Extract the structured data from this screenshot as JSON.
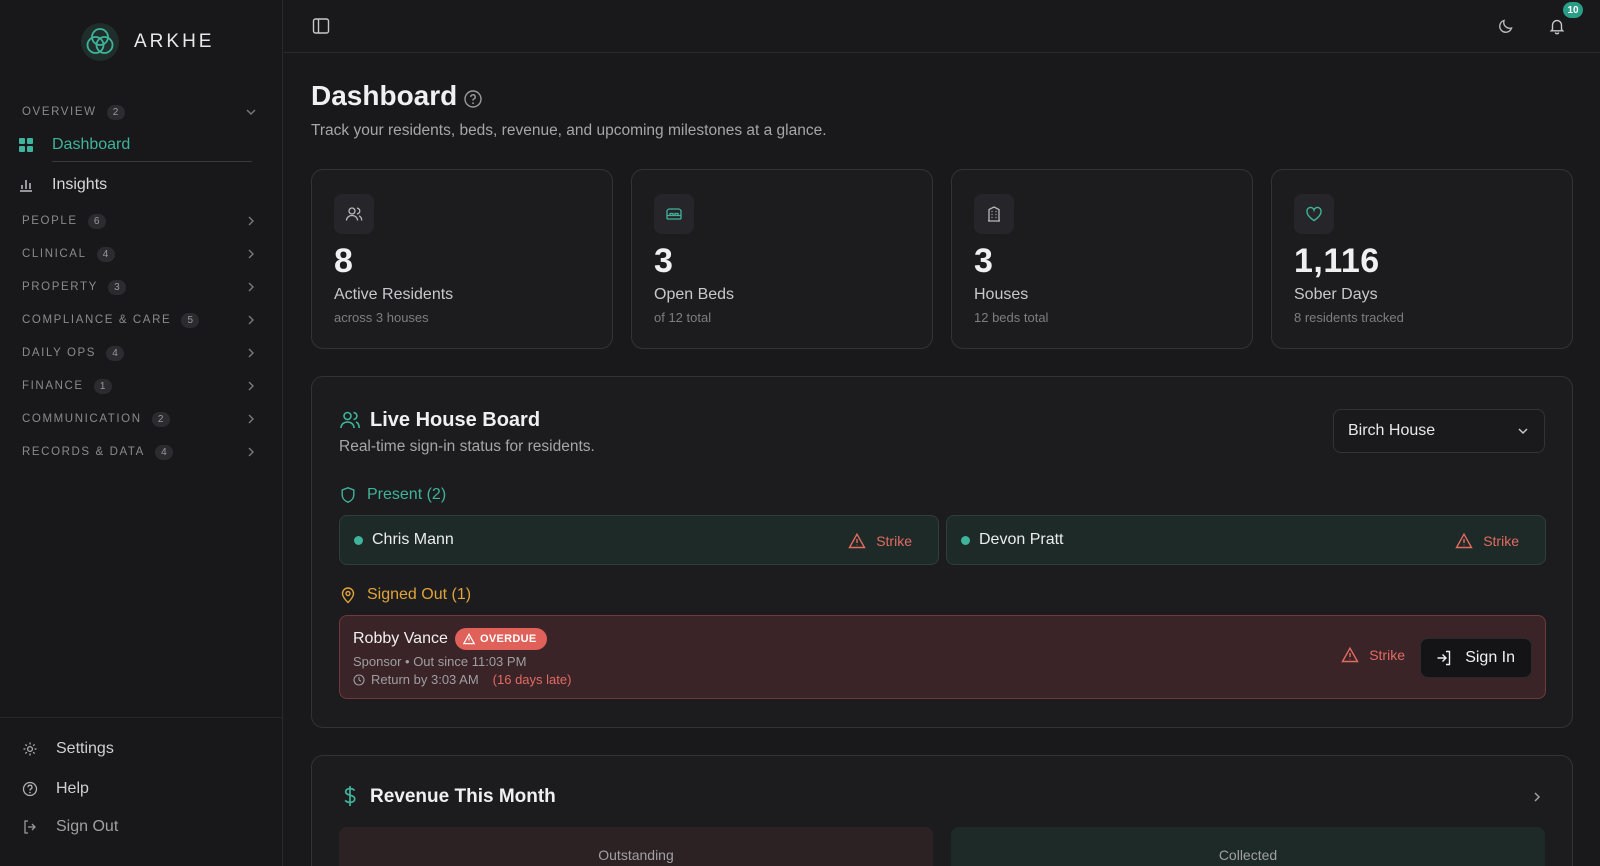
{
  "app": {
    "name": "ARKHE"
  },
  "sidebar": {
    "overview": {
      "label": "OVERVIEW",
      "count": "2"
    },
    "items": [
      {
        "label": "Dashboard"
      },
      {
        "label": "Insights"
      }
    ],
    "groups": [
      {
        "label": "PEOPLE",
        "count": "6"
      },
      {
        "label": "CLINICAL",
        "count": "4"
      },
      {
        "label": "PROPERTY",
        "count": "3"
      },
      {
        "label": "COMPLIANCE & CARE",
        "count": "5"
      },
      {
        "label": "DAILY OPS",
        "count": "4"
      },
      {
        "label": "FINANCE",
        "count": "1"
      },
      {
        "label": "COMMUNICATION",
        "count": "2"
      },
      {
        "label": "RECORDS & DATA",
        "count": "4"
      }
    ],
    "bottom": {
      "settings": "Settings",
      "help": "Help",
      "signout": "Sign Out"
    }
  },
  "topbar": {
    "notification_count": "10"
  },
  "page": {
    "title": "Dashboard",
    "subtitle": "Track your residents, beds, revenue, and upcoming milestones at a glance."
  },
  "stats": [
    {
      "value": "8",
      "label": "Active Residents",
      "sub": "across 3 houses",
      "icon": "users-icon"
    },
    {
      "value": "3",
      "label": "Open Beds",
      "sub": "of 12 total",
      "icon": "bed-icon"
    },
    {
      "value": "3",
      "label": "Houses",
      "sub": "12 beds total",
      "icon": "building-icon"
    },
    {
      "value": "1,116",
      "label": "Sober Days",
      "sub": "8 residents tracked",
      "icon": "heart-icon"
    }
  ],
  "house_board": {
    "title": "Live House Board",
    "subtitle": "Real-time sign-in status for residents.",
    "selected_house": "Birch House",
    "present_label": "Present (2)",
    "present": [
      {
        "name": "Chris Mann",
        "action": "Strike"
      },
      {
        "name": "Devon Pratt",
        "action": "Strike"
      }
    ],
    "signed_out_label": "Signed Out (1)",
    "signed_out": [
      {
        "name": "Robby Vance",
        "badge": "OVERDUE",
        "meta": "Sponsor • Out since 11:03 PM",
        "return": "Return by 3:03 AM",
        "late": "(16 days late)",
        "strike": "Strike",
        "signin": "Sign In"
      }
    ]
  },
  "revenue": {
    "title": "Revenue This Month",
    "outstanding_label": "Outstanding",
    "collected_label": "Collected"
  },
  "colors": {
    "accent": "#3fb39b",
    "warning": "#e0a33a",
    "danger": "#e36b62",
    "background": "#19191b"
  }
}
